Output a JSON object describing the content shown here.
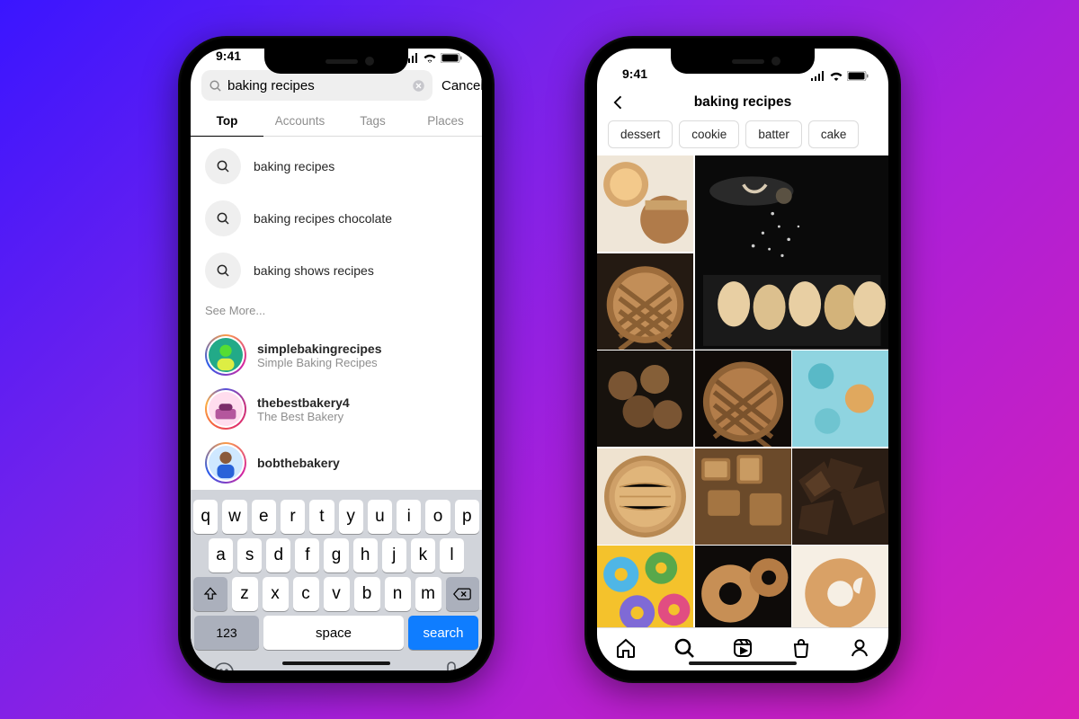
{
  "status": {
    "time": "9:41"
  },
  "phone1": {
    "search": {
      "value": "baking recipes",
      "cancel": "Cancel"
    },
    "tabs": [
      "Top",
      "Accounts",
      "Tags",
      "Places"
    ],
    "active_tab": "Top",
    "suggestions": [
      {
        "label": "baking recipes"
      },
      {
        "label": "baking recipes chocolate"
      },
      {
        "label": "baking shows recipes"
      }
    ],
    "see_more": "See More...",
    "accounts": [
      {
        "user": "simplebakingrecipes",
        "name": "Simple Baking Recipes"
      },
      {
        "user": "thebestbakery4",
        "name": "The Best Bakery"
      },
      {
        "user": "bobthebakery",
        "name": ""
      }
    ],
    "keyboard": {
      "row1": [
        "q",
        "w",
        "e",
        "r",
        "t",
        "y",
        "u",
        "i",
        "o",
        "p"
      ],
      "row2": [
        "a",
        "s",
        "d",
        "f",
        "g",
        "h",
        "j",
        "k",
        "l"
      ],
      "row3": [
        "z",
        "x",
        "c",
        "v",
        "b",
        "n",
        "m"
      ],
      "num": "123",
      "space": "space",
      "action": "search"
    }
  },
  "phone2": {
    "title": "baking recipes",
    "chips": [
      "dessert",
      "cookie",
      "batter",
      "cake"
    ],
    "nav_icons": [
      "home-icon",
      "search-icon",
      "reels-icon",
      "shop-icon",
      "profile-icon"
    ]
  }
}
